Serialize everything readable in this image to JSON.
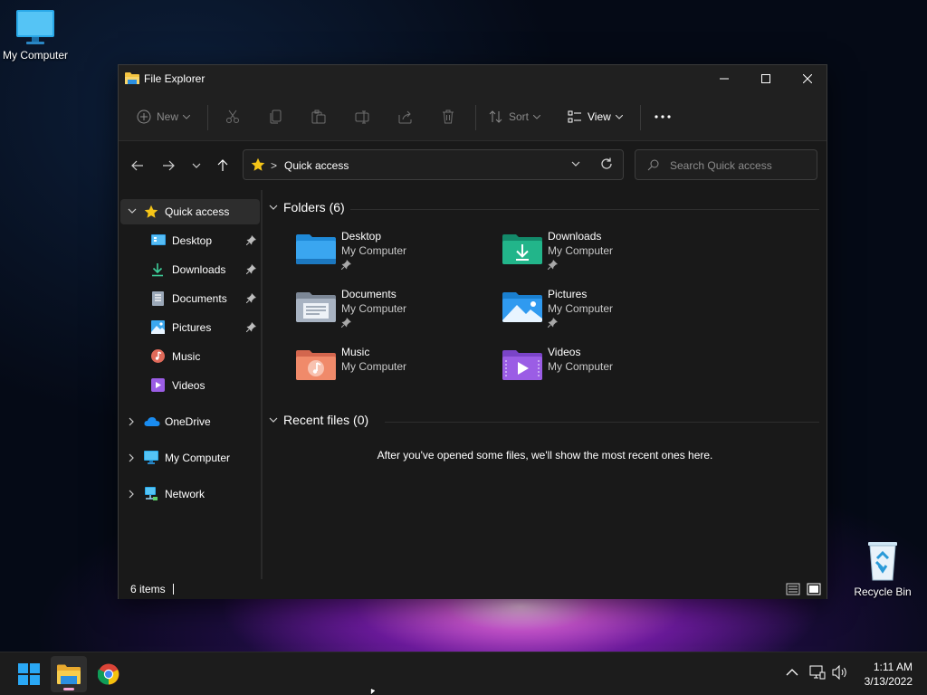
{
  "desktop": {
    "icons": [
      {
        "label": "My Computer"
      },
      {
        "label": "Recycle Bin"
      }
    ]
  },
  "window": {
    "title": "File Explorer",
    "commandbar": {
      "new_label": "New",
      "sort_label": "Sort",
      "view_label": "View"
    },
    "address": {
      "path": "Quick access",
      "separator": ">"
    },
    "search": {
      "placeholder": "Search Quick access"
    },
    "sidebar": {
      "items": [
        {
          "label": "Quick access",
          "icon": "star-icon"
        },
        {
          "label": "Desktop",
          "icon": "desktop-folder-icon"
        },
        {
          "label": "Downloads",
          "icon": "download-icon"
        },
        {
          "label": "Documents",
          "icon": "documents-icon"
        },
        {
          "label": "Pictures",
          "icon": "pictures-icon"
        },
        {
          "label": "Music",
          "icon": "music-icon"
        },
        {
          "label": "Videos",
          "icon": "videos-icon"
        },
        {
          "label": "OneDrive",
          "icon": "cloud-icon"
        },
        {
          "label": "My Computer",
          "icon": "computer-icon"
        },
        {
          "label": "Network",
          "icon": "network-icon"
        }
      ]
    },
    "folders_header": "Folders (6)",
    "folders": [
      {
        "name": "Desktop",
        "location": "My Computer",
        "pinned": true
      },
      {
        "name": "Downloads",
        "location": "My Computer",
        "pinned": true
      },
      {
        "name": "Documents",
        "location": "My Computer",
        "pinned": true
      },
      {
        "name": "Pictures",
        "location": "My Computer",
        "pinned": true
      },
      {
        "name": "Music",
        "location": "My Computer",
        "pinned": false
      },
      {
        "name": "Videos",
        "location": "My Computer",
        "pinned": false
      }
    ],
    "recent_header": "Recent files (0)",
    "recent_empty_message": "After you've opened some files, we'll show the most recent ones here.",
    "status": {
      "item_count": "6 items"
    }
  },
  "taskbar": {
    "clock": {
      "time": "1:11 AM",
      "date": "3/13/2022"
    }
  },
  "colors": {
    "window_bg": "#191919",
    "titlebar_bg": "#202020",
    "folder_blue": "#3aa0f0",
    "folder_yellow": "#f5c542",
    "accent_pink": "#f4a6d3"
  }
}
